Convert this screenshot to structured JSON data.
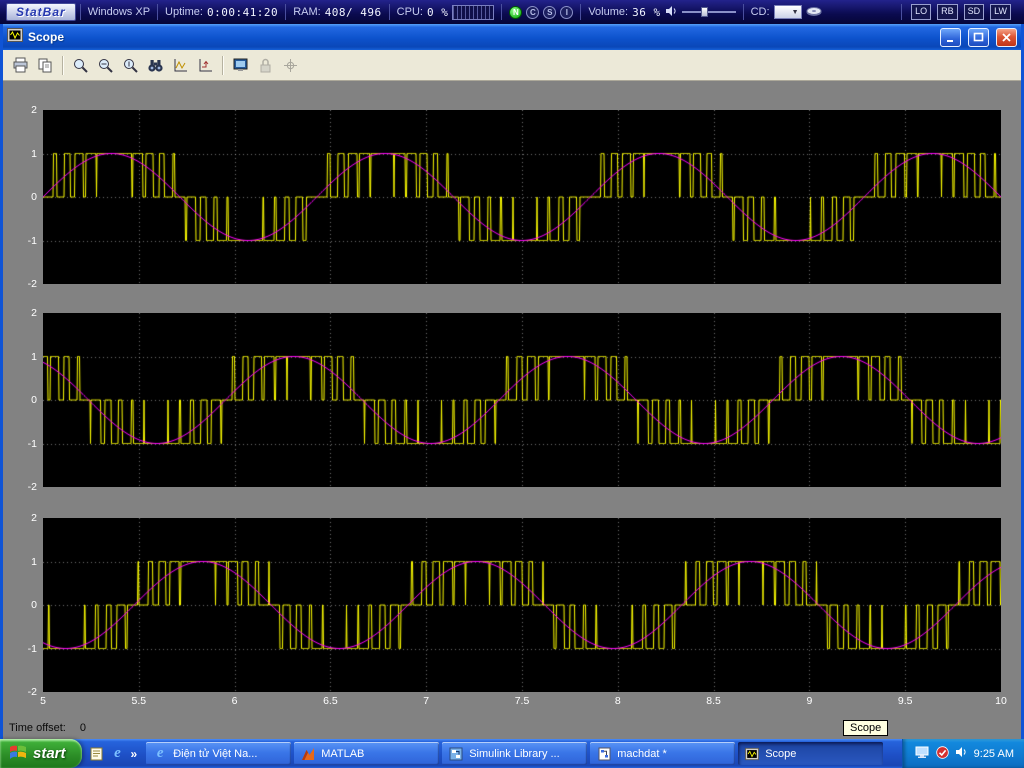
{
  "statbar": {
    "logo": "StatBar",
    "os_label": "Windows XP",
    "uptime_label": "Uptime:",
    "uptime_value": "0:00:41:20",
    "ram_label": "RAM:",
    "ram_value": "408/ 496",
    "cpu_label": "CPU:",
    "cpu_value": "0 %",
    "indicators": [
      "N",
      "C",
      "S",
      "I"
    ],
    "volume_label": "Volume:",
    "volume_value": "36 %",
    "volume_percent": 36,
    "cd_label": "CD:",
    "drive_buttons": [
      "LO",
      "RB",
      "SD",
      "LW"
    ]
  },
  "window": {
    "title": "Scope"
  },
  "toolbar": {
    "icons": [
      "print",
      "copy",
      "zoom",
      "zoom-x",
      "zoom-y",
      "autoscale",
      "save-axes",
      "restore-axes",
      "floating-scope",
      "lock",
      "signal-selection"
    ],
    "disabled_icons": [
      "lock",
      "signal-selection"
    ]
  },
  "scope": {
    "time_offset_label": "Time offset:",
    "time_offset_value": "0"
  },
  "chart_data": {
    "type": "line",
    "title": "",
    "description": "Three stacked Simulink Scope axes showing three-phase sinusoidal PWM: yellow PWM pulse trains (levels -1/0/1) with magenta sine reference waves, phase shifted 0/120/240 degrees",
    "xlim": [
      5,
      10
    ],
    "ylim": [
      -2,
      2
    ],
    "x_ticks": [
      5,
      5.5,
      6,
      6.5,
      7,
      7.5,
      8,
      8.5,
      9,
      9.5,
      10
    ],
    "y_ticks": [
      2,
      1,
      0,
      -1,
      -2
    ],
    "grid": "dotted",
    "background": "#000000",
    "plots": [
      {
        "name": "axes-1",
        "phase_deg": 0
      },
      {
        "name": "axes-2",
        "phase_deg": 120
      },
      {
        "name": "axes-3",
        "phase_deg": 240
      }
    ],
    "signal": {
      "fundamental_hz": 0.7,
      "carrier_ratio": 23,
      "modulation_index": 1.0,
      "pwm_levels": [
        -1,
        0,
        1
      ],
      "pwm_color": "#ffff00",
      "reference_color": "#ff00ff",
      "grid_color": "rgba(225,225,225,0.5)"
    }
  },
  "tooltip": {
    "text": "Scope"
  },
  "icons": {
    "internet_explorer": "e"
  },
  "taskbar": {
    "start_label": "start",
    "overflow_chevron": "»",
    "tasks": [
      {
        "label": "Điện tử Việt Na...",
        "icon": "internet-explorer",
        "active": false
      },
      {
        "label": "MATLAB",
        "icon": "matlab",
        "active": false
      },
      {
        "label": "Simulink Library ...",
        "icon": "simulink",
        "active": false
      },
      {
        "label": "machdat *",
        "icon": "simulink-model",
        "active": false
      },
      {
        "label": "Scope",
        "icon": "scope",
        "active": true
      }
    ],
    "tray_icons": [
      "display",
      "antivirus",
      "volume"
    ],
    "clock": "9:25 AM"
  }
}
